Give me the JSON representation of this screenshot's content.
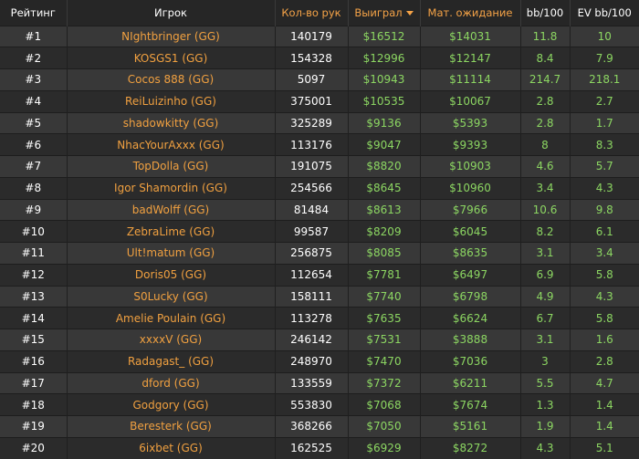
{
  "colors": {
    "accent_orange": "#f5a347",
    "player_orange": "#f0a040",
    "money_green": "#8cd662",
    "row_light": "#383838",
    "row_dark": "#2b2b2b"
  },
  "header": {
    "rank": "Рейтинг",
    "player": "Игрок",
    "hands": "Кол-во рук",
    "won": "Выиграл",
    "ev": "Мат. ожидание",
    "bb100": "bb/100",
    "evbb100": "EV bb/100",
    "sort_icon": "caret-down-icon"
  },
  "rows": [
    {
      "rank": "#1",
      "player": "NIghtbringer (GG)",
      "hands": "140179",
      "won": "$16512",
      "ev": "$14031",
      "bb": "11.8",
      "evbb": "10"
    },
    {
      "rank": "#2",
      "player": "KOSGS1 (GG)",
      "hands": "154328",
      "won": "$12996",
      "ev": "$12147",
      "bb": "8.4",
      "evbb": "7.9"
    },
    {
      "rank": "#3",
      "player": "Cocos 888 (GG)",
      "hands": "5097",
      "won": "$10943",
      "ev": "$11114",
      "bb": "214.7",
      "evbb": "218.1"
    },
    {
      "rank": "#4",
      "player": "ReiLuizinho (GG)",
      "hands": "375001",
      "won": "$10535",
      "ev": "$10067",
      "bb": "2.8",
      "evbb": "2.7"
    },
    {
      "rank": "#5",
      "player": "shadowkitty (GG)",
      "hands": "325289",
      "won": "$9136",
      "ev": "$5393",
      "bb": "2.8",
      "evbb": "1.7"
    },
    {
      "rank": "#6",
      "player": "NhacYourAxxx (GG)",
      "hands": "113176",
      "won": "$9047",
      "ev": "$9393",
      "bb": "8",
      "evbb": "8.3"
    },
    {
      "rank": "#7",
      "player": "TopDolla (GG)",
      "hands": "191075",
      "won": "$8820",
      "ev": "$10903",
      "bb": "4.6",
      "evbb": "5.7"
    },
    {
      "rank": "#8",
      "player": "Igor Shamordin (GG)",
      "hands": "254566",
      "won": "$8645",
      "ev": "$10960",
      "bb": "3.4",
      "evbb": "4.3"
    },
    {
      "rank": "#9",
      "player": "badWolff (GG)",
      "hands": "81484",
      "won": "$8613",
      "ev": "$7966",
      "bb": "10.6",
      "evbb": "9.8"
    },
    {
      "rank": "#10",
      "player": "ZebraLime (GG)",
      "hands": "99587",
      "won": "$8209",
      "ev": "$6045",
      "bb": "8.2",
      "evbb": "6.1"
    },
    {
      "rank": "#11",
      "player": "Ult!matum (GG)",
      "hands": "256875",
      "won": "$8085",
      "ev": "$8635",
      "bb": "3.1",
      "evbb": "3.4"
    },
    {
      "rank": "#12",
      "player": "Doris05 (GG)",
      "hands": "112654",
      "won": "$7781",
      "ev": "$6497",
      "bb": "6.9",
      "evbb": "5.8"
    },
    {
      "rank": "#13",
      "player": "S0Lucky (GG)",
      "hands": "158111",
      "won": "$7740",
      "ev": "$6798",
      "bb": "4.9",
      "evbb": "4.3"
    },
    {
      "rank": "#14",
      "player": "Amelie Poulain (GG)",
      "hands": "113278",
      "won": "$7635",
      "ev": "$6624",
      "bb": "6.7",
      "evbb": "5.8"
    },
    {
      "rank": "#15",
      "player": "xxxxV (GG)",
      "hands": "246142",
      "won": "$7531",
      "ev": "$3888",
      "bb": "3.1",
      "evbb": "1.6"
    },
    {
      "rank": "#16",
      "player": "Radagast_ (GG)",
      "hands": "248970",
      "won": "$7470",
      "ev": "$7036",
      "bb": "3",
      "evbb": "2.8"
    },
    {
      "rank": "#17",
      "player": "dford (GG)",
      "hands": "133559",
      "won": "$7372",
      "ev": "$6211",
      "bb": "5.5",
      "evbb": "4.7"
    },
    {
      "rank": "#18",
      "player": "Godgory (GG)",
      "hands": "553830",
      "won": "$7068",
      "ev": "$7674",
      "bb": "1.3",
      "evbb": "1.4"
    },
    {
      "rank": "#19",
      "player": "Beresterk (GG)",
      "hands": "368266",
      "won": "$7050",
      "ev": "$5161",
      "bb": "1.9",
      "evbb": "1.4"
    },
    {
      "rank": "#20",
      "player": "6ixbet (GG)",
      "hands": "162525",
      "won": "$6929",
      "ev": "$8272",
      "bb": "4.3",
      "evbb": "5.1"
    }
  ]
}
